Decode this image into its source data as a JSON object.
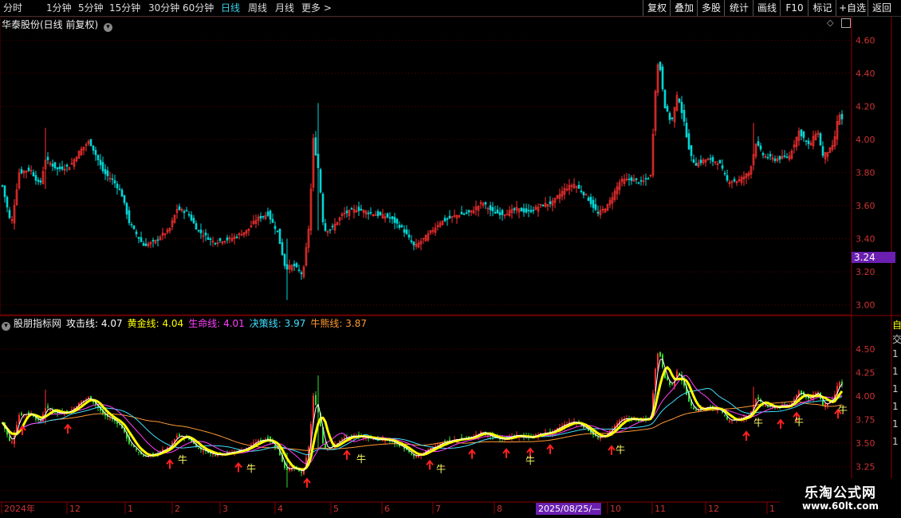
{
  "toolbar": {
    "periods": [
      "分时",
      "1分钟",
      "5分钟",
      "15分钟",
      "30分钟",
      "60分钟",
      "日线",
      "周线",
      "月线",
      "更多周期"
    ],
    "periods_more": "更多 >",
    "active": "日线",
    "right_buttons": [
      "复权",
      "叠加",
      "多股",
      "统计",
      "画线",
      "F10",
      "标记",
      "+自选",
      "返回"
    ]
  },
  "main_chart": {
    "title": "华泰股份(日线 前复权)",
    "y_ticks": [
      "4.60",
      "4.40",
      "4.20",
      "4.00",
      "3.80",
      "3.60",
      "3.40",
      "3.20",
      "3.00"
    ],
    "y_ticks_values": [
      4.6,
      4.4,
      4.2,
      4.0,
      3.8,
      3.6,
      3.4,
      3.2,
      3.0
    ],
    "ylim": [
      2.94,
      4.67
    ],
    "current_price": "3.24"
  },
  "indicator": {
    "name": "股朋指标网",
    "lines": [
      {
        "label": "攻击线:",
        "value": "4.07",
        "color": "#ffffff"
      },
      {
        "label": "黄金线:",
        "value": "4.04",
        "color": "#ffff00"
      },
      {
        "label": "生命线:",
        "value": "4.01",
        "color": "#ff40ff"
      },
      {
        "label": "决策线:",
        "value": "3.97",
        "color": "#40e0ff"
      },
      {
        "label": "牛熊线:",
        "value": "3.87",
        "color": "#ff9933"
      }
    ],
    "y_ticks": [
      "4.50",
      "4.25",
      "4.00",
      "3.75",
      "3.50",
      "3.25",
      "3.00"
    ],
    "y_ticks_values": [
      4.5,
      4.25,
      4.0,
      3.75,
      3.5,
      3.25,
      3.0
    ],
    "ylim": [
      2.96,
      4.72
    ],
    "bull_label": "牛",
    "signal_up_x": [
      28,
      85,
      213,
      299,
      385,
      435,
      539,
      592,
      635,
      665,
      690,
      767,
      936,
      979,
      999,
      1051
    ],
    "bull_x": [
      229,
      315,
      453,
      553,
      665,
      778,
      951,
      1002,
      1057
    ]
  },
  "time_axis": {
    "labels": [
      "2024年",
      "12",
      "1",
      "2",
      "3",
      "4",
      "5",
      "6",
      "7",
      "8",
      "9",
      "10",
      "11",
      "12",
      "1"
    ],
    "cursor_date": "2025/08/25/—"
  },
  "colors": {
    "up": "#ff3232",
    "down": "#00d7d7",
    "ind_up": "#ff3232",
    "ind_down": "#33dd33",
    "grid": "#5a0000",
    "axis_text": "#cc3333",
    "price_tag": "#6a1fb0",
    "toolbar_active": "#3ad0e8"
  },
  "watermark": {
    "title": "乐淘公式网",
    "url": "www.60lt.com"
  },
  "right_panel_fragments": [
    "自",
    "交",
    "1",
    "1",
    "1",
    "1",
    "1",
    "1"
  ]
}
